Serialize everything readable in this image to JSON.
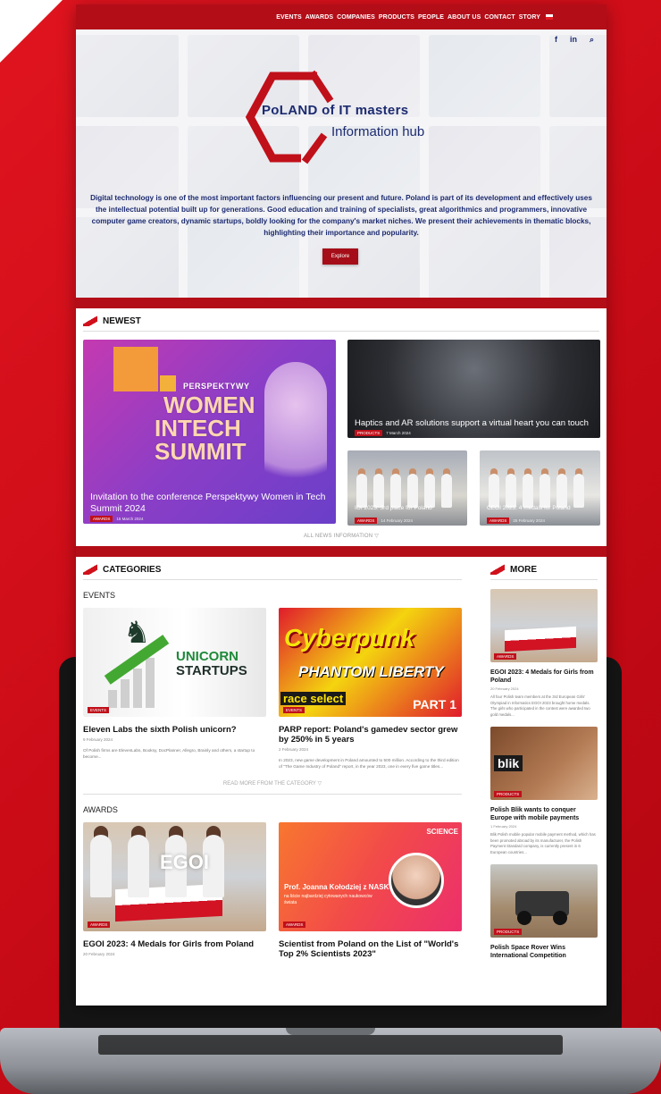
{
  "nav": {
    "items": [
      "EVENTS",
      "AWARDS",
      "COMPANIES",
      "PRODUCTS",
      "PEOPLE",
      "ABOUT US",
      "CONTACT",
      "STORY"
    ]
  },
  "hero": {
    "social": [
      "f",
      "in",
      "⌕"
    ],
    "logo_title": "PoLAND of IT masters",
    "logo_sub": "Information hub",
    "text": "Digital technology is one of the most important factors influencing our present and future. Poland is part of its development and effectively uses the intellectual potential built up for generations. Good education and training of specialists, great algorithmics and programmers, innovative computer game creators, dynamic startups, boldly looking for the company's market niches. We present their achievements in thematic blocks, highlighting their importance and popularity.",
    "explore_label": "Explore"
  },
  "newest": {
    "heading": "NEWEST",
    "summit_words": [
      "PERSPEKTYWY",
      "WOMEN",
      "INTECH",
      "SUMMIT"
    ],
    "cards": [
      {
        "title": "Invitation to the conference Perspektywy Women in Tech Summit 2024",
        "badge": "Awards",
        "date": "15 March 2024"
      },
      {
        "title": "Haptics and AR solutions support a virtual heart you can touch",
        "badge": "Products",
        "date": "7 March 2024"
      },
      {
        "title": "IOI 2023: 3rd place for Poland",
        "badge": "Awards",
        "date": "14 February 2024"
      },
      {
        "title": "CEOI 2023: 4 medals for Poland",
        "badge": "Awards",
        "date": "25 February 2024"
      }
    ],
    "all_label": "ALL NEWS INFORMATION ▽"
  },
  "categories": {
    "heading": "CATEGORIES",
    "events": {
      "label": "EVENTS",
      "items": [
        {
          "title": "Eleven Labs the sixth Polish unicorn?",
          "badge": "Events",
          "date": "9 February 2024",
          "excerpt": "Of Polish firms are ElevenLabs, Booksy, DocPlanner, Allegro, Brainly and others, a startup to become...",
          "graphic_text": [
            "UNICORN",
            "STARTUPS"
          ]
        },
        {
          "title": "PARP report: Poland's gamedev sector grew by 250% in 5 years",
          "badge": "Events",
          "date": "2 February 2024",
          "excerpt": "In 2023, new game development in Poland amounted to 500 million. According to the third edition of \"The Game Industry of Poland\" report, in the year 2023, one in every five game titles...",
          "graphic_text": [
            "Cyberpunk",
            "PHANTOM LIBERTY",
            "race select",
            "PART 1"
          ]
        }
      ],
      "read_more": "READ MORE FROM THE CATEGORY ▽"
    },
    "awards": {
      "label": "AWARDS",
      "items": [
        {
          "title": "EGOI 2023: 4 Medals for Girls from Poland",
          "badge": "Awards",
          "date": "20 February 2024",
          "graphic_text": "EGOI"
        },
        {
          "title": "Scientist from Poland on the List of \"World's Top 2% Scientists 2023\"",
          "badge": "Awards",
          "date": "",
          "graphic_text": [
            "SCIENCE",
            "Prof. Joanna Kołodziej z NASK",
            "na liście najbardziej cytowanych naukowców świata"
          ]
        }
      ]
    }
  },
  "more": {
    "heading": "MORE",
    "items": [
      {
        "title": "EGOI 2023: 4 Medals for Girls from Poland",
        "badge": "Awards",
        "date": "20 February 2024",
        "excerpt": "All four Polish team members at the 3rd European Girls' Olympiad in Informatics EGOI 2023 brought home medals. The girls who participated in the contest were awarded two gold medals..."
      },
      {
        "title": "Polish Blik wants to conquer Europe with mobile payments",
        "badge": "Products",
        "date": "1 February 2024",
        "excerpt": "Blik Polish mobile popular mobile payment method, which has been promoted abroad by its manufacturer, the Polish Payment Standard company, is currently present in 6 European countries...",
        "logo_text": "blik"
      },
      {
        "title": "Polish Space Rover Wins International Competition",
        "badge": "Products",
        "date": "",
        "excerpt": ""
      }
    ]
  },
  "colors": {
    "brand_red": "#b30d18",
    "navy": "#1c2b70",
    "accent_red": "#d0101b"
  }
}
